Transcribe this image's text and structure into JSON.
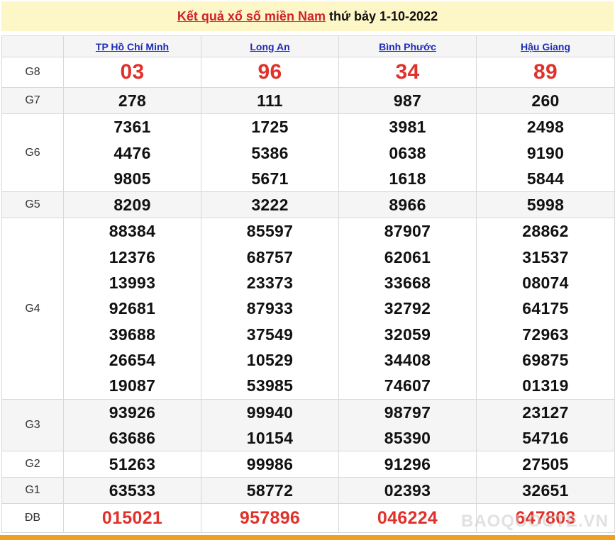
{
  "header": {
    "title_link": "Kết quả xổ số miền Nam",
    "title_rest": "thứ bảy 1-10-2022"
  },
  "provinces": [
    "TP Hồ Chí Minh",
    "Long An",
    "Bình Phước",
    "Hậu Giang"
  ],
  "prizes": [
    {
      "label": "G8",
      "results": [
        [
          "03"
        ],
        [
          "96"
        ],
        [
          "34"
        ],
        [
          "89"
        ]
      ]
    },
    {
      "label": "G7",
      "results": [
        [
          "278"
        ],
        [
          "111"
        ],
        [
          "987"
        ],
        [
          "260"
        ]
      ]
    },
    {
      "label": "G6",
      "results": [
        [
          "7361",
          "4476",
          "9805"
        ],
        [
          "1725",
          "5386",
          "5671"
        ],
        [
          "3981",
          "0638",
          "1618"
        ],
        [
          "2498",
          "9190",
          "5844"
        ]
      ]
    },
    {
      "label": "G5",
      "results": [
        [
          "8209"
        ],
        [
          "3222"
        ],
        [
          "8966"
        ],
        [
          "5998"
        ]
      ]
    },
    {
      "label": "G4",
      "results": [
        [
          "88384",
          "12376",
          "13993",
          "92681",
          "39688",
          "26654",
          "19087"
        ],
        [
          "85597",
          "68757",
          "23373",
          "87933",
          "37549",
          "10529",
          "53985"
        ],
        [
          "87907",
          "62061",
          "33668",
          "32792",
          "32059",
          "34408",
          "74607"
        ],
        [
          "28862",
          "31537",
          "08074",
          "64175",
          "72963",
          "69875",
          "01319"
        ]
      ]
    },
    {
      "label": "G3",
      "results": [
        [
          "93926",
          "63686"
        ],
        [
          "99940",
          "10154"
        ],
        [
          "98797",
          "85390"
        ],
        [
          "23127",
          "54716"
        ]
      ]
    },
    {
      "label": "G2",
      "results": [
        [
          "51263"
        ],
        [
          "99986"
        ],
        [
          "91296"
        ],
        [
          "27505"
        ]
      ]
    },
    {
      "label": "G1",
      "results": [
        [
          "63533"
        ],
        [
          "58772"
        ],
        [
          "02393"
        ],
        [
          "32651"
        ]
      ]
    },
    {
      "label": "ĐB",
      "results": [
        [
          "015021"
        ],
        [
          "957896"
        ],
        [
          "046224"
        ],
        [
          "647803"
        ]
      ]
    }
  ],
  "watermark": "BAOQUOCTE.VN",
  "colors": {
    "banner_bg": "#fdf6c6",
    "title_red": "#d0232a",
    "special_red": "#e0312a",
    "province_link": "#1d2cb6",
    "bottom_bar": "#f0a020"
  }
}
